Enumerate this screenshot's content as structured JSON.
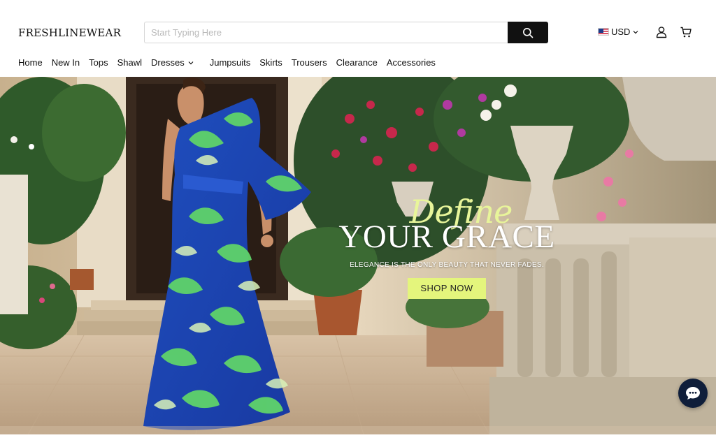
{
  "brand": {
    "logo_text": "FRESHLINEWEAR"
  },
  "search": {
    "placeholder": "Start Typing Here",
    "value": ""
  },
  "header": {
    "currency_label": "USD",
    "currency_flag": "us-flag-icon",
    "account_icon": "user-icon",
    "cart_icon": "cart-icon"
  },
  "nav": {
    "items": [
      {
        "label": "Home"
      },
      {
        "label": "New In"
      },
      {
        "label": "Tops"
      },
      {
        "label": "Shawl"
      },
      {
        "label": "Dresses",
        "has_dropdown": true
      },
      {
        "label": "Jumpsuits"
      },
      {
        "label": "Skirts"
      },
      {
        "label": "Trousers"
      },
      {
        "label": "Clearance"
      },
      {
        "label": "Accessories"
      }
    ]
  },
  "hero": {
    "script_text": "Define",
    "title": "YOUR GRACE",
    "subtitle": "ELEGANCE IS THE ONLY BEAUTY THAT NEVER FADES.",
    "cta_label": "SHOP NOW"
  },
  "chat": {
    "icon": "chat-bubble-icon"
  },
  "colors": {
    "accent": "#e4f57c",
    "script": "#e8f59a",
    "search_button": "#111111",
    "chat_button": "#0f1e3a"
  }
}
